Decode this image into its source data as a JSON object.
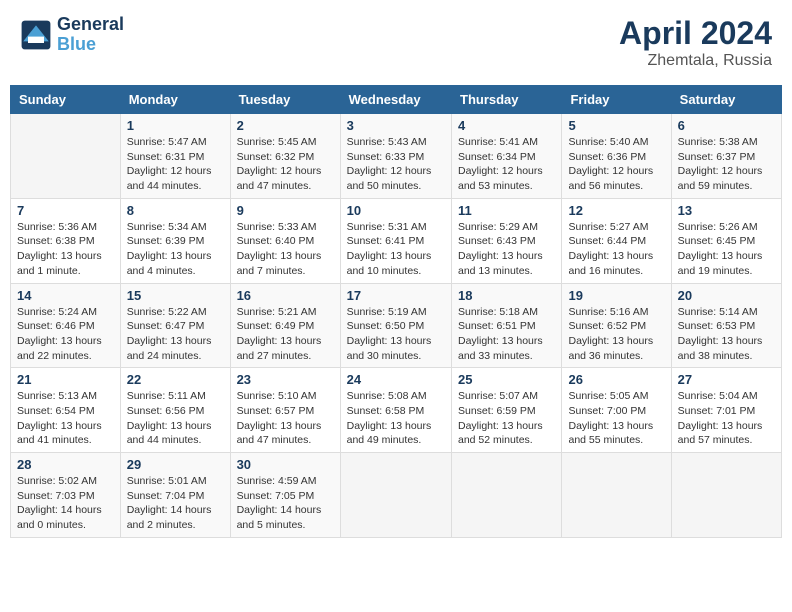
{
  "header": {
    "logo_line1": "General",
    "logo_line2": "Blue",
    "month": "April 2024",
    "location": "Zhemtala, Russia"
  },
  "weekdays": [
    "Sunday",
    "Monday",
    "Tuesday",
    "Wednesday",
    "Thursday",
    "Friday",
    "Saturday"
  ],
  "weeks": [
    [
      {
        "day": "",
        "info": ""
      },
      {
        "day": "1",
        "info": "Sunrise: 5:47 AM\nSunset: 6:31 PM\nDaylight: 12 hours\nand 44 minutes."
      },
      {
        "day": "2",
        "info": "Sunrise: 5:45 AM\nSunset: 6:32 PM\nDaylight: 12 hours\nand 47 minutes."
      },
      {
        "day": "3",
        "info": "Sunrise: 5:43 AM\nSunset: 6:33 PM\nDaylight: 12 hours\nand 50 minutes."
      },
      {
        "day": "4",
        "info": "Sunrise: 5:41 AM\nSunset: 6:34 PM\nDaylight: 12 hours\nand 53 minutes."
      },
      {
        "day": "5",
        "info": "Sunrise: 5:40 AM\nSunset: 6:36 PM\nDaylight: 12 hours\nand 56 minutes."
      },
      {
        "day": "6",
        "info": "Sunrise: 5:38 AM\nSunset: 6:37 PM\nDaylight: 12 hours\nand 59 minutes."
      }
    ],
    [
      {
        "day": "7",
        "info": "Sunrise: 5:36 AM\nSunset: 6:38 PM\nDaylight: 13 hours\nand 1 minute."
      },
      {
        "day": "8",
        "info": "Sunrise: 5:34 AM\nSunset: 6:39 PM\nDaylight: 13 hours\nand 4 minutes."
      },
      {
        "day": "9",
        "info": "Sunrise: 5:33 AM\nSunset: 6:40 PM\nDaylight: 13 hours\nand 7 minutes."
      },
      {
        "day": "10",
        "info": "Sunrise: 5:31 AM\nSunset: 6:41 PM\nDaylight: 13 hours\nand 10 minutes."
      },
      {
        "day": "11",
        "info": "Sunrise: 5:29 AM\nSunset: 6:43 PM\nDaylight: 13 hours\nand 13 minutes."
      },
      {
        "day": "12",
        "info": "Sunrise: 5:27 AM\nSunset: 6:44 PM\nDaylight: 13 hours\nand 16 minutes."
      },
      {
        "day": "13",
        "info": "Sunrise: 5:26 AM\nSunset: 6:45 PM\nDaylight: 13 hours\nand 19 minutes."
      }
    ],
    [
      {
        "day": "14",
        "info": "Sunrise: 5:24 AM\nSunset: 6:46 PM\nDaylight: 13 hours\nand 22 minutes."
      },
      {
        "day": "15",
        "info": "Sunrise: 5:22 AM\nSunset: 6:47 PM\nDaylight: 13 hours\nand 24 minutes."
      },
      {
        "day": "16",
        "info": "Sunrise: 5:21 AM\nSunset: 6:49 PM\nDaylight: 13 hours\nand 27 minutes."
      },
      {
        "day": "17",
        "info": "Sunrise: 5:19 AM\nSunset: 6:50 PM\nDaylight: 13 hours\nand 30 minutes."
      },
      {
        "day": "18",
        "info": "Sunrise: 5:18 AM\nSunset: 6:51 PM\nDaylight: 13 hours\nand 33 minutes."
      },
      {
        "day": "19",
        "info": "Sunrise: 5:16 AM\nSunset: 6:52 PM\nDaylight: 13 hours\nand 36 minutes."
      },
      {
        "day": "20",
        "info": "Sunrise: 5:14 AM\nSunset: 6:53 PM\nDaylight: 13 hours\nand 38 minutes."
      }
    ],
    [
      {
        "day": "21",
        "info": "Sunrise: 5:13 AM\nSunset: 6:54 PM\nDaylight: 13 hours\nand 41 minutes."
      },
      {
        "day": "22",
        "info": "Sunrise: 5:11 AM\nSunset: 6:56 PM\nDaylight: 13 hours\nand 44 minutes."
      },
      {
        "day": "23",
        "info": "Sunrise: 5:10 AM\nSunset: 6:57 PM\nDaylight: 13 hours\nand 47 minutes."
      },
      {
        "day": "24",
        "info": "Sunrise: 5:08 AM\nSunset: 6:58 PM\nDaylight: 13 hours\nand 49 minutes."
      },
      {
        "day": "25",
        "info": "Sunrise: 5:07 AM\nSunset: 6:59 PM\nDaylight: 13 hours\nand 52 minutes."
      },
      {
        "day": "26",
        "info": "Sunrise: 5:05 AM\nSunset: 7:00 PM\nDaylight: 13 hours\nand 55 minutes."
      },
      {
        "day": "27",
        "info": "Sunrise: 5:04 AM\nSunset: 7:01 PM\nDaylight: 13 hours\nand 57 minutes."
      }
    ],
    [
      {
        "day": "28",
        "info": "Sunrise: 5:02 AM\nSunset: 7:03 PM\nDaylight: 14 hours\nand 0 minutes."
      },
      {
        "day": "29",
        "info": "Sunrise: 5:01 AM\nSunset: 7:04 PM\nDaylight: 14 hours\nand 2 minutes."
      },
      {
        "day": "30",
        "info": "Sunrise: 4:59 AM\nSunset: 7:05 PM\nDaylight: 14 hours\nand 5 minutes."
      },
      {
        "day": "",
        "info": ""
      },
      {
        "day": "",
        "info": ""
      },
      {
        "day": "",
        "info": ""
      },
      {
        "day": "",
        "info": ""
      }
    ]
  ]
}
